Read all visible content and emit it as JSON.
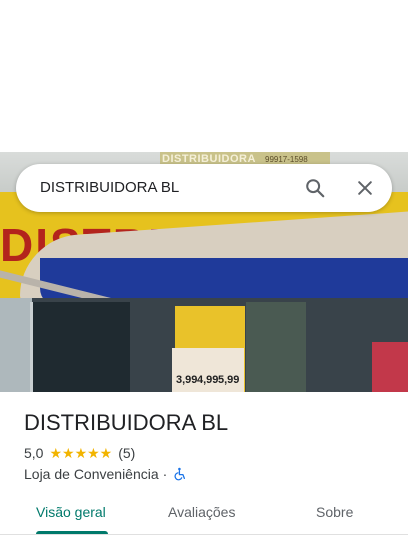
{
  "search": {
    "value": "DISTRIBUIDORA BL"
  },
  "photo": {
    "sign_text": "DISTRIBUIDORA",
    "sign_phone": "99917-1598",
    "facade_text": "DISTRIBUIDORA",
    "prices": [
      "3,99",
      "4,99",
      "5,99"
    ]
  },
  "place": {
    "name": "DISTRIBUIDORA BL",
    "rating": "5,0",
    "stars": "★★★★★",
    "review_count": "(5)",
    "category": "Loja de Conveniência",
    "separator": "·"
  },
  "tabs": [
    {
      "label": "Visão geral",
      "active": true
    },
    {
      "label": "Avaliações",
      "active": false
    },
    {
      "label": "Sobre",
      "active": false
    }
  ],
  "colors": {
    "accent": "#00796b",
    "star": "#f2b400",
    "accessibility": "#1a73e8"
  }
}
